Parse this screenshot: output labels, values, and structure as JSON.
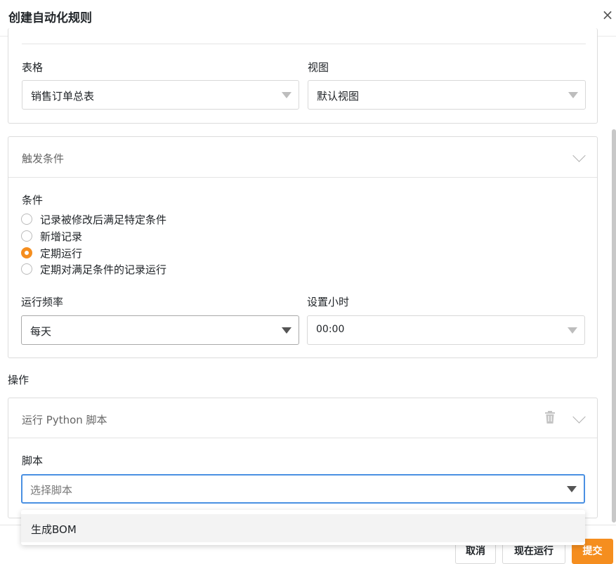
{
  "dialog": {
    "title": "创建自动化规则"
  },
  "source": {
    "table_label": "表格",
    "table_value": "销售订单总表",
    "view_label": "视图",
    "view_value": "默认视图"
  },
  "trigger": {
    "header": "触发条件",
    "condition_label": "条件",
    "options": [
      {
        "label": "记录被修改后满足特定条件",
        "checked": false
      },
      {
        "label": "新增记录",
        "checked": false
      },
      {
        "label": "定期运行",
        "checked": true
      },
      {
        "label": "定期对满足条件的记录运行",
        "checked": false
      }
    ],
    "frequency_label": "运行频率",
    "frequency_value": "每天",
    "hour_label": "设置小时",
    "hour_value": "00:00"
  },
  "actions": {
    "section_label": "操作",
    "action_header": "运行 Python 脚本",
    "script_label": "脚本",
    "script_placeholder": "选择脚本",
    "dropdown_options": [
      "生成BOM"
    ]
  },
  "footer": {
    "cancel": "取消",
    "run_now": "现在运行",
    "submit": "提交"
  },
  "colors": {
    "accent": "#f58e1f",
    "focus_border": "#4a90e2"
  }
}
